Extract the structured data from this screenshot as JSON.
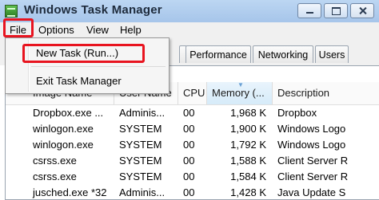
{
  "window": {
    "title": "Windows Task Manager",
    "icon": "task-manager-icon",
    "buttons": [
      "minimize-icon",
      "maximize-icon",
      "close-icon"
    ]
  },
  "menubar": {
    "items": [
      "File",
      "Options",
      "View",
      "Help"
    ]
  },
  "file_menu": {
    "items": [
      "New Task (Run...)",
      "Exit Task Manager"
    ]
  },
  "tabs": {
    "visible": [
      "Performance",
      "Networking",
      "Users"
    ]
  },
  "table": {
    "columns": [
      "Image Name",
      "User Name",
      "CPU",
      "Memory (...",
      "Description"
    ],
    "rows": [
      {
        "name": "Dropbox.exe ...",
        "user": "Adminis...",
        "cpu": "00",
        "memory": "1,968 K",
        "description": "Dropbox"
      },
      {
        "name": "winlogon.exe",
        "user": "SYSTEM",
        "cpu": "00",
        "memory": "1,900 K",
        "description": "Windows Logo"
      },
      {
        "name": "winlogon.exe",
        "user": "SYSTEM",
        "cpu": "00",
        "memory": "1,792 K",
        "description": "Windows Logo"
      },
      {
        "name": "csrss.exe",
        "user": "SYSTEM",
        "cpu": "00",
        "memory": "1,588 K",
        "description": "Client Server R"
      },
      {
        "name": "csrss.exe",
        "user": "SYSTEM",
        "cpu": "00",
        "memory": "1,584 K",
        "description": "Client Server R"
      },
      {
        "name": "jusched.exe *32",
        "user": "Adminis...",
        "cpu": "00",
        "memory": "1,428 K",
        "description": "Java Update S"
      }
    ]
  },
  "colors": {
    "highlight": "#e8141f",
    "titlebar": "#bcd6f2",
    "sorted_header": "#d6ebf9"
  }
}
